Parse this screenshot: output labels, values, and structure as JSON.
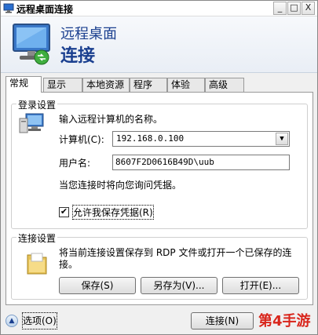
{
  "window": {
    "title": "远程桌面连接",
    "controls": {
      "minimize": "_",
      "maximize": "□",
      "close": "X"
    }
  },
  "header": {
    "title": "远程桌面",
    "subtitle": "连接",
    "icon": "remote-desktop-monitor-icon"
  },
  "tabs": [
    {
      "label": "常规",
      "active": true
    },
    {
      "label": "显示",
      "active": false
    },
    {
      "label": "本地资源",
      "active": false
    },
    {
      "label": "程序",
      "active": false
    },
    {
      "label": "体验",
      "active": false
    },
    {
      "label": "高级",
      "active": false
    }
  ],
  "login_group": {
    "legend": "登录设置",
    "instruction": "输入远程计算机的名称。",
    "computer_label": "计算机(C):",
    "computer_value": "192.168.0.100",
    "user_label": "用户名:",
    "user_value": "8607F2D0616B49D\\uub",
    "prompt_text": "当您连接时将向您询问凭据。",
    "save_credentials_label": "允许我保存凭据(R)",
    "save_credentials_checked": "✔"
  },
  "connection_group": {
    "legend": "连接设置",
    "description_line1": "将当前连接设置保存到 RDP 文件或打开一个已保存的连",
    "description_line2": "接。",
    "save_button": "保存(S)",
    "save_as_button": "另存为(V)...",
    "open_button": "打开(E)..."
  },
  "footer": {
    "options_label": "选项(O)",
    "connect_button": "连接(N)",
    "watermark": "第4手游"
  }
}
